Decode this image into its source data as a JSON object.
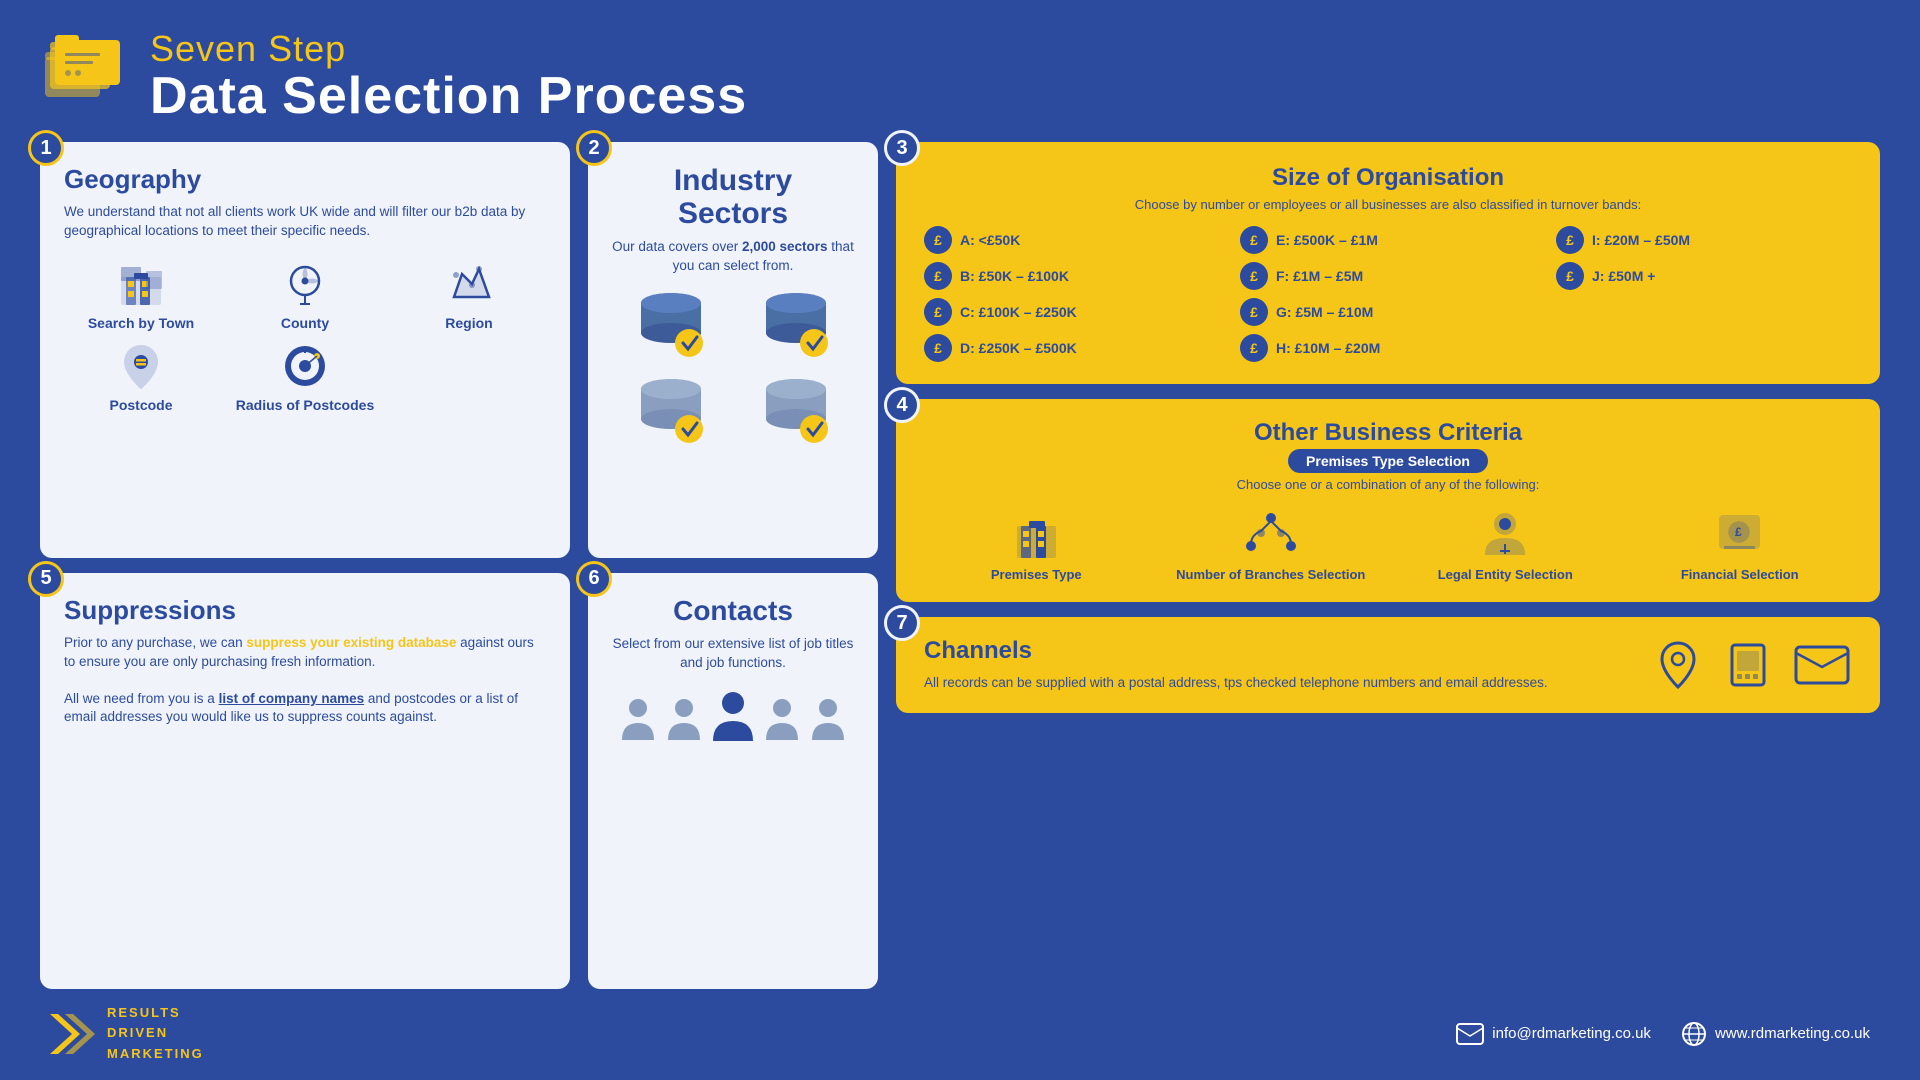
{
  "header": {
    "subtitle": "Seven Step",
    "title": "Data Selection Process"
  },
  "step1": {
    "number": "1",
    "title": "Geography",
    "desc": "We understand that not all clients work UK wide and will filter our b2b data by geographical locations to meet their specific needs.",
    "items": [
      {
        "label": "Search by Town",
        "icon": "🏢"
      },
      {
        "label": "County",
        "icon": "📍"
      },
      {
        "label": "Region",
        "icon": "🗺️"
      },
      {
        "label": "Postcode",
        "icon": "📮"
      },
      {
        "label": "Radius of Postcodes",
        "icon": "🔵"
      }
    ]
  },
  "step2": {
    "number": "2",
    "title": "Industry Sectors",
    "desc_pre": "Our data covers over ",
    "desc_bold": "2,000 sectors",
    "desc_post": " that you can select from."
  },
  "step3": {
    "number": "3",
    "title": "Size of Organisation",
    "desc": "Choose by number or employees or all businesses are also classified in turnover bands:",
    "items": [
      "A: <£50K",
      "E: £500K – £1M",
      "I: £20M – £50M",
      "B: £50K – £100K",
      "F: £1M – £5M",
      "J: £50M +",
      "C: £100K – £250K",
      "G: £5M – £10M",
      "",
      "D: £250K – £500K",
      "H: £10M – £20M",
      ""
    ]
  },
  "step4": {
    "number": "4",
    "title": "Other Business Criteria",
    "badge": "Premises Type Selection",
    "desc": "Choose one or a combination of any of the following:",
    "items": [
      {
        "label": "Premises Type",
        "icon": "🏢"
      },
      {
        "label": "Number of Branches Selection",
        "icon": "📍"
      },
      {
        "label": "Legal Entity Selection",
        "icon": "👤"
      },
      {
        "label": "Financial Selection",
        "icon": "💷"
      }
    ]
  },
  "step5": {
    "number": "5",
    "title": "Suppressions",
    "desc1_pre": "Prior to any purchase, we can ",
    "desc1_highlight": "suppress your existing database",
    "desc1_post": " against ours to ensure you are only purchasing fresh information.",
    "desc2_pre": "All we need from you is a ",
    "desc2_highlight": "list of company names",
    "desc2_post": " and postcodes or a list of email addresses you would like us to suppress counts against."
  },
  "step6": {
    "number": "6",
    "title": "Contacts",
    "desc": "Select from our extensive list of job titles and job functions."
  },
  "step7": {
    "number": "7",
    "title": "Channels",
    "desc": "All records can be supplied with a postal address, tps checked telephone numbers and email addresses."
  },
  "footer": {
    "logo_line1": "RESULTS",
    "logo_line2": "DRIVEN",
    "logo_line3": "MARKETING",
    "email": "info@rdmarketing.co.uk",
    "website": "www.rdmarketing.co.uk"
  },
  "colors": {
    "bg": "#2d4b9e",
    "yellow": "#f5c518",
    "white": "#ffffff",
    "darkblue": "#1e3a7a"
  }
}
